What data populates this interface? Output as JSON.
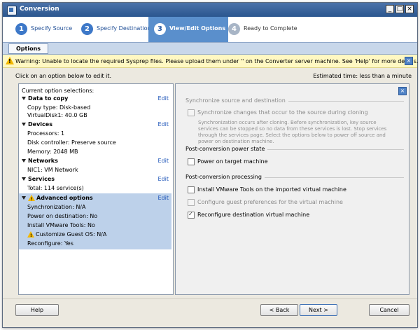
{
  "window": {
    "title": "Conversion"
  },
  "steps": [
    {
      "num": "1",
      "label": "Specify Source",
      "state": "done"
    },
    {
      "num": "2",
      "label": "Specify Destination",
      "state": "done"
    },
    {
      "num": "3",
      "label": "View/Edit Options",
      "state": "active"
    },
    {
      "num": "4",
      "label": "Ready to Complete",
      "state": "future"
    }
  ],
  "tabs": {
    "options": "Options"
  },
  "warning": {
    "text": "Warning: Unable to locate the required Sysprep files. Please upload them under '' on the Converter server machine. See 'Help' for more details."
  },
  "hint": "Click on an option below to edit it.",
  "estimated": {
    "label": "Estimated time:",
    "value": "less than a minute"
  },
  "left": {
    "heading": "Current option selections:",
    "edit": "Edit",
    "data_to_copy": {
      "title": "Data to copy",
      "lines": [
        "Copy type: Disk-based",
        "VirtualDisk1: 40.0 GB"
      ]
    },
    "devices": {
      "title": "Devices",
      "lines": [
        "Processors: 1",
        "Disk controller: Preserve source",
        "Memory: 2048 MB"
      ]
    },
    "networks": {
      "title": "Networks",
      "lines": [
        "NIC1: VM Network"
      ]
    },
    "services": {
      "title": "Services",
      "lines": [
        "Total: 114 service(s)"
      ]
    },
    "advanced": {
      "title": "Advanced options",
      "lines": [
        "Synchronization: N/A",
        "Power on destination: No",
        "Install VMware Tools: No",
        "Customize Guest OS: N/A",
        "Reconfigure: Yes"
      ]
    }
  },
  "right": {
    "sync_section": "Synchronize source and destination",
    "sync_option": "Synchronize changes that occur to the source during cloning",
    "sync_desc": "Synchronization occurs after cloning. Before synchronization, key source services can be stopped so no data from these services is lost. Stop services through the services page. Select the options below to power off source and power on destination machine.",
    "power_section": "Post-conversion power state",
    "power_option": "Power on target machine",
    "processing_section": "Post-conversion processing",
    "tools_option": "Install VMware Tools on the imported virtual machine",
    "guest_option": "Configure guest preferences for the virtual machine",
    "reconfig_option": "Reconfigure destination virtual machine",
    "reconfig_checked": true
  },
  "buttons": {
    "help": "Help",
    "back": "< Back",
    "next": "Next >",
    "cancel": "Cancel"
  },
  "colors": {
    "accent": "#5a8fcc",
    "selection": "#bdd1ea",
    "warning_bg": "#fff8c2",
    "link": "#1d54b8"
  }
}
